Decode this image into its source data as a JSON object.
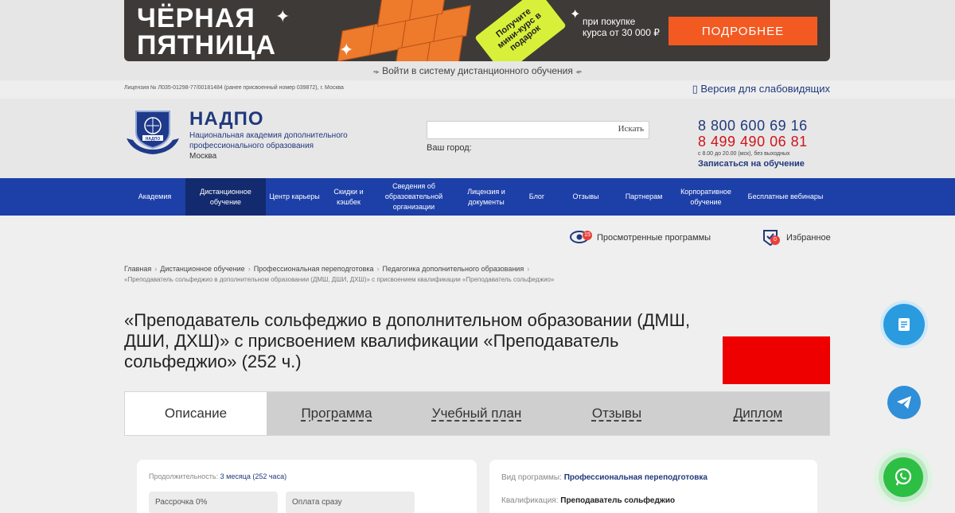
{
  "banner": {
    "title_line1": "ЧЁРНАЯ",
    "title_line2": "ПЯТНИЦА",
    "tag_text": "Получите мини-курс в подарок",
    "sub_line1": "при покупке",
    "sub_line2": "курса от 30 000 ₽",
    "button_label": "ПОДРОБНЕЕ",
    "login_text": "Войти в систему дистанционного обучения"
  },
  "top_bar": {
    "license": "Лицензия № Л035-01298-77/00181484 (ранее присвоенный номер 039872), г. Москва",
    "low_vision": "Версия для слабовидящих"
  },
  "header": {
    "logo_text": "НАДПО",
    "brand_name": "НАДПО",
    "brand_desc_line1": "Национальная академия дополнительного",
    "brand_desc_line2": "профессионального образования",
    "brand_city": "Москва",
    "search_placeholder": "",
    "search_button": "Искать",
    "city_label": "Ваш город:",
    "phone1": "8 800 600 69 16",
    "phone2": "8 499 490 06 81",
    "hours": "с 8.00 до 20.00 (мск), без выходных",
    "enroll": "Записаться на обучение"
  },
  "nav": [
    {
      "label": "Академия",
      "active": false
    },
    {
      "label": "Дистанционное обучение",
      "active": true
    },
    {
      "label": "Центр карьеры",
      "active": false
    },
    {
      "label": "Скидки и кэшбек",
      "active": false
    },
    {
      "label": "Сведения об образовательной организации",
      "active": false
    },
    {
      "label": "Лицензия и документы",
      "active": false
    },
    {
      "label": "Блог",
      "active": false
    },
    {
      "label": "Отзывы",
      "active": false
    },
    {
      "label": "Партнерам",
      "active": false
    },
    {
      "label": "Корпоративное обучение",
      "active": false
    },
    {
      "label": "Бесплатные вебинары",
      "active": false
    }
  ],
  "quick_links": {
    "viewed_label": "Просмотренные программы",
    "viewed_count": "15",
    "fav_label": "Избранное",
    "fav_count": "0"
  },
  "breadcrumbs": {
    "items": [
      "Главная",
      "Дистанционное обучение",
      "Профессиональная переподготовка",
      "Педагогика дополнительного образования"
    ],
    "current": "«Преподаватель сольфеджио в дополнительном образовании (ДМШ, ДШИ, ДХШ)» с присвоением квалификации «Преподаватель сольфеджио»"
  },
  "page_title": "«Преподаватель сольфеджио в дополнительном образовании (ДМШ, ДШИ, ДХШ)» с присвоением квалификации «Преподаватель сольфеджио» (252 ч.)",
  "tabs": [
    {
      "label": "Описание",
      "active": true
    },
    {
      "label": "Программа",
      "active": false
    },
    {
      "label": "Учебный план",
      "active": false
    },
    {
      "label": "Отзывы",
      "active": false
    },
    {
      "label": "Диплом",
      "active": false
    }
  ],
  "left_card": {
    "duration_label": "Продолжительность:",
    "duration_value": "3 месяца (252 часа)",
    "installment_label": "Рассрочка 0%",
    "pay_now_label": "Оплата сразу"
  },
  "right_card": {
    "type_label": "Вид программы:",
    "type_value": "Профессиональная переподготовка",
    "qual_label": "Квалификация:",
    "qual_value": "Преподаватель сольфеджио"
  },
  "colors": {
    "brand_blue": "#21397d",
    "nav_blue": "#1d3fa8",
    "accent_orange": "#f25a22",
    "phone_red": "#d0151b"
  }
}
